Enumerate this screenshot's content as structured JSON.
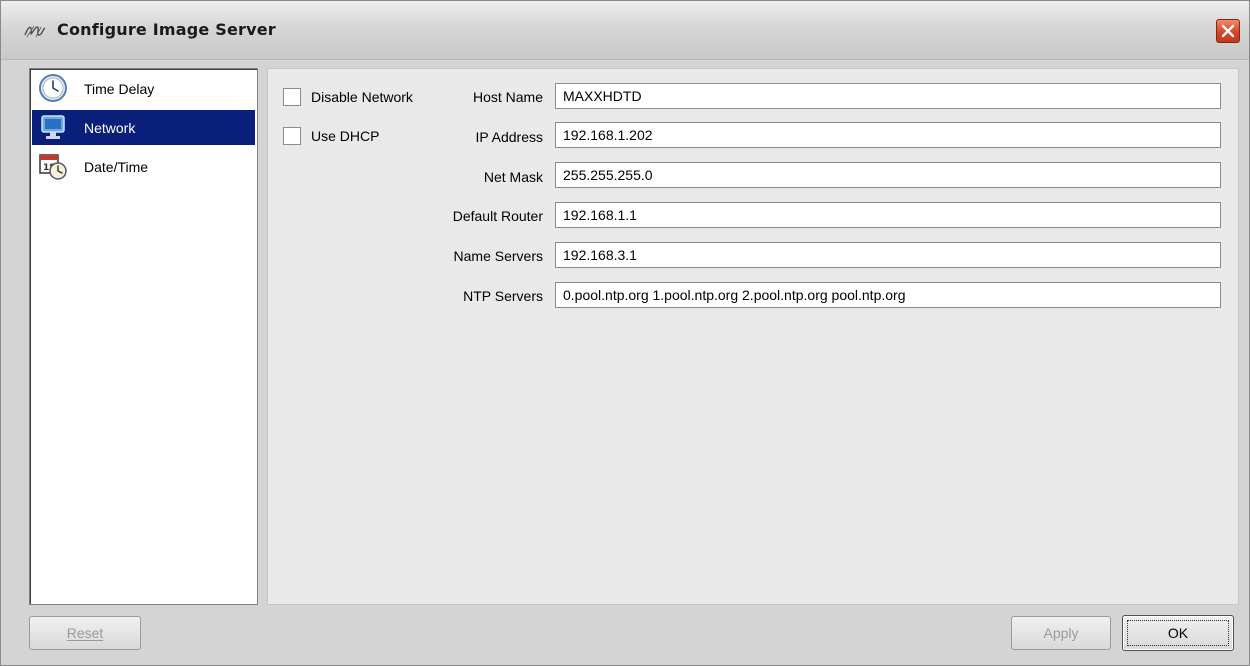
{
  "window": {
    "title": "Configure Image Server",
    "close_icon": "close-icon"
  },
  "sidebar": {
    "items": [
      {
        "label": "Time Delay",
        "icon": "clock-icon",
        "selected": false
      },
      {
        "label": "Network",
        "icon": "monitor-icon",
        "selected": true
      },
      {
        "label": "Date/Time",
        "icon": "calendar-clock-icon",
        "selected": false
      }
    ]
  },
  "network": {
    "disable_network": {
      "label": "Disable Network",
      "checked": false
    },
    "use_dhcp": {
      "label": "Use DHCP",
      "checked": false
    },
    "fields": [
      {
        "label": "Host Name",
        "value": "MAXXHDTD"
      },
      {
        "label": "IP Address",
        "value": "192.168.1.202"
      },
      {
        "label": "Net Mask",
        "value": "255.255.255.0"
      },
      {
        "label": "Default Router",
        "value": "192.168.1.1"
      },
      {
        "label": "Name Servers",
        "value": "192.168.3.1"
      },
      {
        "label": "NTP Servers",
        "value": "0.pool.ntp.org  1.pool.ntp.org  2.pool.ntp.org  pool.ntp.org"
      }
    ]
  },
  "buttons": {
    "reset": {
      "label": "Reset",
      "mnemonic": "R",
      "enabled": false
    },
    "apply": {
      "label": "Apply",
      "mnemonic": "A",
      "enabled": false
    },
    "ok": {
      "label": "OK",
      "mnemonic": "O",
      "enabled": true
    }
  },
  "colors": {
    "selection": "#0a1f7a",
    "close_button": "#d9442a"
  }
}
